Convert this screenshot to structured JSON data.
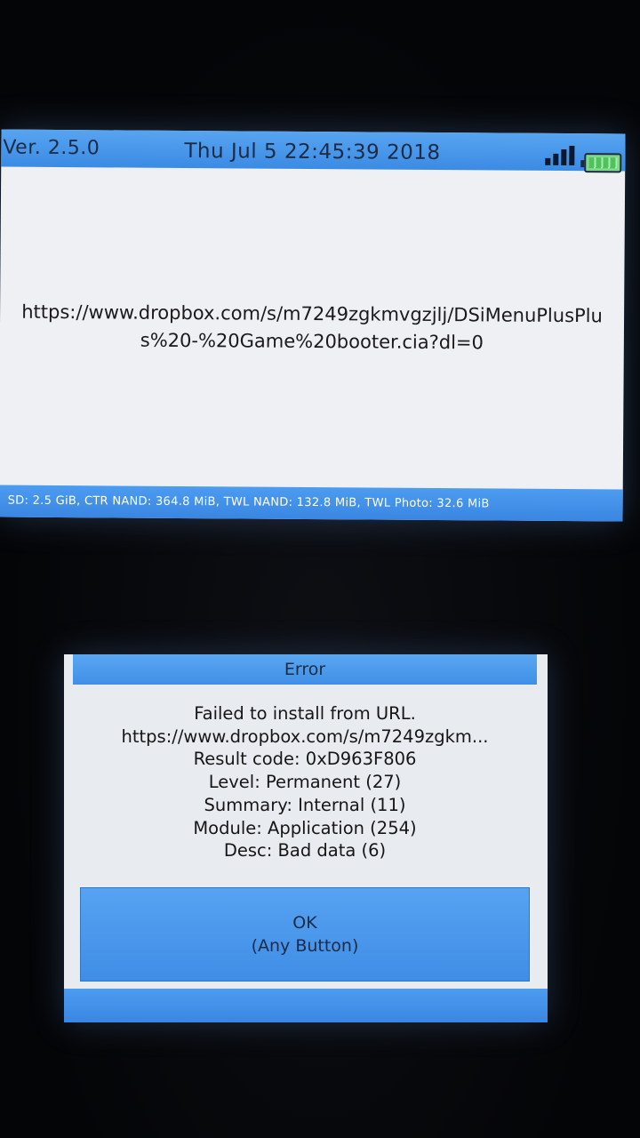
{
  "top_screen": {
    "version": "Ver. 2.5.0",
    "datetime": "Thu Jul  5 22:45:39 2018",
    "signal_icon": "signal-strength-icon",
    "battery_icon": "battery-full-icon",
    "url": "https://www.dropbox.com/s/m7249zgkmvgzjlj/DSiMenuPlusPlus%20-%20Game%20booter.cia?dl=0",
    "storage": "SD: 2.5 GiB, CTR NAND: 364.8 MiB, TWL NAND: 132.8 MiB, TWL Photo: 32.6 MiB"
  },
  "error_dialog": {
    "title": "Error",
    "lines": [
      "Failed to install from URL.",
      "https://www.dropbox.com/s/m7249zgkm...",
      "Result code: 0xD963F806",
      "Level: Permanent (27)",
      "Summary: Internal (11)",
      "Module: Application (254)",
      "Desc: Bad data (6)"
    ],
    "ok_label": "OK",
    "ok_hint": "(Any Button)"
  },
  "colors": {
    "bar_blue": "#3b8be4",
    "screen_bg": "#eef0f4"
  }
}
